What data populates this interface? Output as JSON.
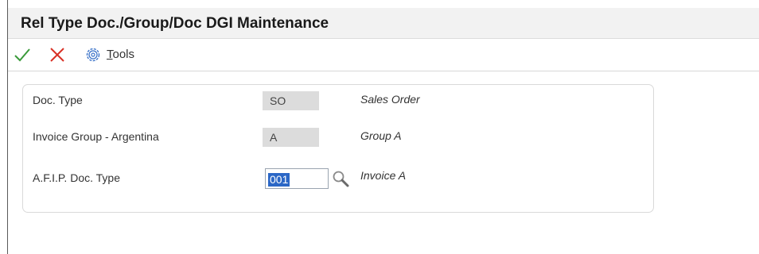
{
  "window": {
    "title": "Rel Type Doc./Group/Doc DGI Maintenance"
  },
  "toolbar": {
    "ok_icon": "checkmark-icon",
    "cancel_icon": "close-icon",
    "tools_icon": "gear-icon",
    "tools_label_accel": "T",
    "tools_label_rest": "ools"
  },
  "form": {
    "doc_type": {
      "label": "Doc. Type",
      "value": "SO",
      "description": "Sales Order"
    },
    "invoice_group": {
      "label": "Invoice Group - Argentina",
      "value": "A",
      "description": "Group A"
    },
    "afip_doc_type": {
      "label": "A.F.I.P. Doc. Type",
      "value": "001",
      "description": "Invoice A",
      "search_icon": "search-icon"
    }
  },
  "colors": {
    "ok": "#3a9a3a",
    "cancel": "#d93025",
    "accent": "#2b67c6"
  }
}
